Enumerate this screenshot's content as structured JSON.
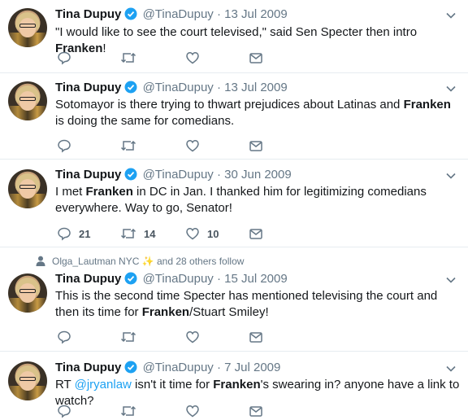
{
  "tweets": [
    {
      "author": "Tina Dupuy",
      "handle": "@TinaDupuy",
      "date": "13 Jul 2009",
      "parts": [
        {
          "t": "\"I would like to see the court televised,\" said Sen Specter then intro "
        },
        {
          "t": "Franken",
          "b": true
        },
        {
          "t": "!"
        }
      ],
      "reply_count": "",
      "retweet_count": "",
      "like_count": ""
    },
    {
      "author": "Tina Dupuy",
      "handle": "@TinaDupuy",
      "date": "13 Jul 2009",
      "parts": [
        {
          "t": "Sotomayor is there trying to thwart prejudices about Latinas and "
        },
        {
          "t": "Franken",
          "b": true
        },
        {
          "t": " is doing the same for comedians."
        }
      ],
      "reply_count": "",
      "retweet_count": "",
      "like_count": ""
    },
    {
      "author": "Tina Dupuy",
      "handle": "@TinaDupuy",
      "date": "30 Jun 2009",
      "parts": [
        {
          "t": "I met "
        },
        {
          "t": "Franken",
          "b": true
        },
        {
          "t": " in DC in Jan. I thanked him for legitimizing comedians everywhere. Way to go, Senator!"
        }
      ],
      "reply_count": "21",
      "retweet_count": "14",
      "like_count": "10"
    },
    {
      "social_context": "Olga_Lautman NYC ✨ and 28 others follow",
      "author": "Tina Dupuy",
      "handle": "@TinaDupuy",
      "date": "15 Jul 2009",
      "parts": [
        {
          "t": "This is the second time Specter has mentioned televising the court and then its time for "
        },
        {
          "t": "Franken",
          "b": true
        },
        {
          "t": "/Stuart Smiley!"
        }
      ],
      "reply_count": "",
      "retweet_count": "",
      "like_count": ""
    },
    {
      "author": "Tina Dupuy",
      "handle": "@TinaDupuy",
      "date": "7 Jul 2009",
      "parts": [
        {
          "t": "RT "
        },
        {
          "t": "@jryanlaw",
          "m": true
        },
        {
          "t": " isn't it time for "
        },
        {
          "t": "Franken",
          "b": true
        },
        {
          "t": "'s swearing in? anyone have a link to watch?"
        }
      ],
      "reply_count": "",
      "retweet_count": "",
      "like_count": ""
    }
  ],
  "dot": "·",
  "colors": {
    "accent": "#1da1f2",
    "muted": "#657786",
    "border": "#e6ecf0"
  },
  "icons": [
    "verified-badge-icon",
    "chevron-down-icon",
    "reply-icon",
    "retweet-icon",
    "like-icon",
    "message-icon",
    "person-icon"
  ]
}
